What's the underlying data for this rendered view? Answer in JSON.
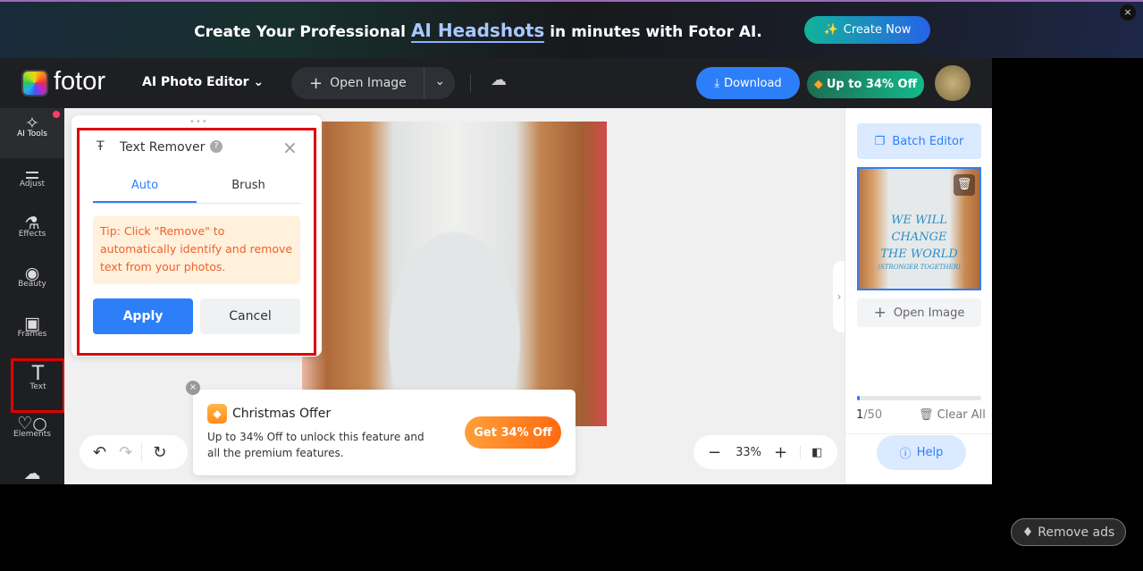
{
  "banner": {
    "pre": "Create Your Professional",
    "highlight": "AI Headshots",
    "post": "in minutes with Fotor AI.",
    "cta": "Create Now",
    "close": "×"
  },
  "header": {
    "logo": "fotor",
    "editor_menu": "AI Photo Editor",
    "open_image": "Open Image",
    "download": "Download",
    "promo": "Up to 34% Off"
  },
  "sidebar": {
    "items": [
      {
        "label": "AI Tools",
        "icon": "sparkle-icon"
      },
      {
        "label": "Adjust",
        "icon": "sliders-icon"
      },
      {
        "label": "Effects",
        "icon": "flask-icon"
      },
      {
        "label": "Beauty",
        "icon": "eye-icon"
      },
      {
        "label": "Frames",
        "icon": "frame-icon"
      },
      {
        "label": "Text",
        "icon": "text-icon"
      },
      {
        "label": "Elements",
        "icon": "shapes-icon"
      },
      {
        "label": "",
        "icon": "upload-cloud-icon"
      }
    ]
  },
  "text_remover": {
    "title": "Text Remover",
    "tabs": [
      "Auto",
      "Brush"
    ],
    "active_tab": "Auto",
    "tip": "Tip: Click \"Remove\" to automatically identify and remove text from your photos.",
    "apply": "Apply",
    "cancel": "Cancel"
  },
  "offer": {
    "title": "Christmas Offer",
    "body": "Up to 34% Off to unlock this feature and all the premium features.",
    "cta": "Get 34% Off"
  },
  "zoom": {
    "level": "33%"
  },
  "right_panel": {
    "batch_editor": "Batch Editor",
    "open_image": "Open Image",
    "count_current": "1",
    "count_total": "/50",
    "progress": 0.02,
    "clear_all": "Clear All",
    "help": "Help",
    "thumb_text": [
      "WE WILL",
      "CHANGE",
      "THE WORLD",
      "(STRONGER TOGETHER)"
    ]
  },
  "remove_ads": "Remove ads",
  "colors": {
    "accent": "#2d7ff9",
    "highlight_box": "#e00000",
    "tip_text": "#f0602a",
    "offer": "#ff7a1c"
  }
}
